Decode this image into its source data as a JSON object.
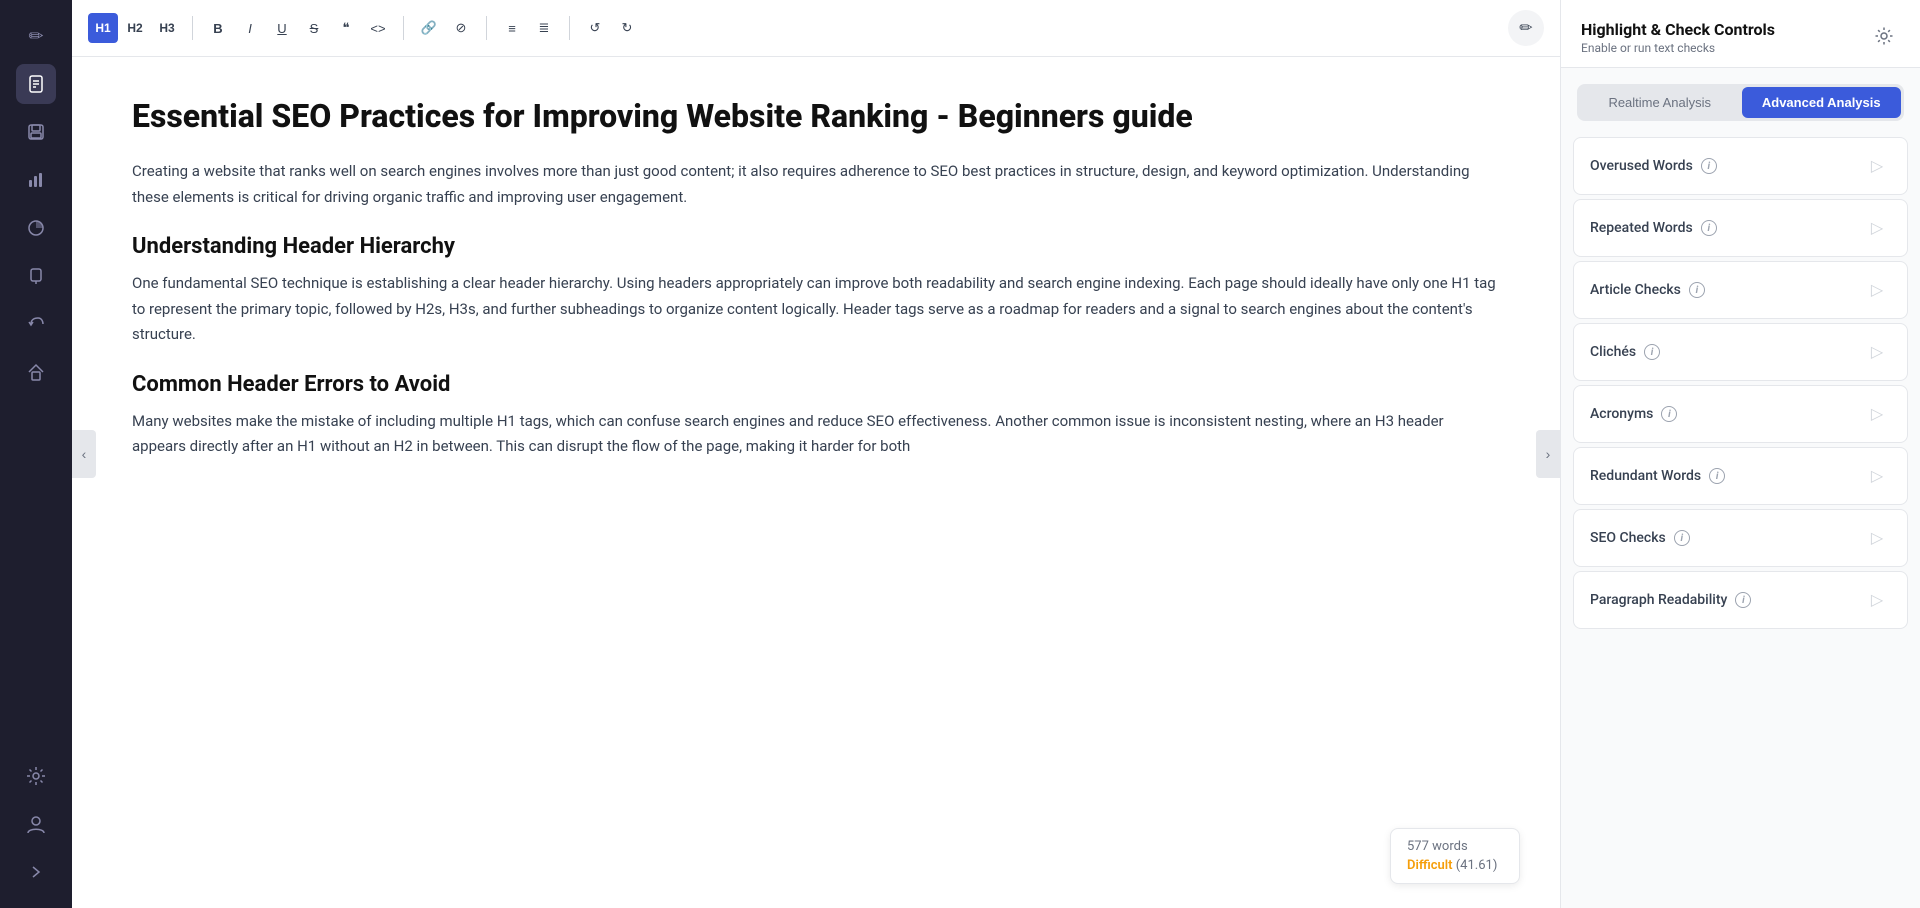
{
  "sidebar": {
    "icons": [
      {
        "name": "edit-icon",
        "symbol": "✏️",
        "active": false
      },
      {
        "name": "document-icon",
        "symbol": "📄",
        "active": true
      },
      {
        "name": "save-icon",
        "symbol": "💾",
        "active": false
      },
      {
        "name": "chart-bar-icon",
        "symbol": "📊",
        "active": false
      },
      {
        "name": "pie-chart-icon",
        "symbol": "🥧",
        "active": false
      },
      {
        "name": "marker-icon",
        "symbol": "🖊️",
        "active": false
      },
      {
        "name": "undo-icon",
        "symbol": "↩",
        "active": false
      },
      {
        "name": "home-icon",
        "symbol": "⌂",
        "active": false
      },
      {
        "name": "settings-icon",
        "symbol": "⚙",
        "active": false
      },
      {
        "name": "user-icon",
        "symbol": "👤",
        "active": false
      },
      {
        "name": "arrow-right-icon",
        "symbol": "→",
        "active": false
      }
    ]
  },
  "toolbar": {
    "h1_label": "H1",
    "h2_label": "H2",
    "h3_label": "H3",
    "bold_label": "B",
    "italic_label": "I",
    "underline_label": "U",
    "strikethrough_label": "S",
    "quote_label": "❝",
    "code_label": "<>",
    "link_label": "🔗",
    "clear_label": "⊘",
    "list_label": "≡",
    "ordered_list_label": "≣",
    "undo_label": "↺",
    "redo_label": "↻",
    "edit_icon": "✏"
  },
  "editor": {
    "title": "Essential SEO Practices for Improving Website Ranking - Beginners guide",
    "paragraphs": [
      "Creating a website that ranks well on search engines involves more than just good content; it also requires adherence to SEO best practices in structure, design, and keyword optimization. Understanding these elements is critical for driving organic traffic and improving user engagement.",
      "",
      "Understanding Header Hierarchy",
      "One fundamental SEO technique is establishing a clear header hierarchy. Using headers appropriately can improve both readability and search engine indexing. Each page should ideally have only one H1 tag to represent the primary topic, followed by H2s, H3s, and further subheadings to organize content logically. Header tags serve as a roadmap for readers and a signal to search engines about the content's structure.",
      "Common Header Errors to Avoid",
      "Many websites make the mistake of including multiple H1 tags, which can confuse search engines and reduce SEO effectiveness. Another common issue is inconsistent nesting, where an H3 header appears directly after an H1 without an H2 in between. This can disrupt the flow of the page, making it harder for both"
    ],
    "word_count": "577 words",
    "difficulty_label": "Difficult",
    "difficulty_score": "(41.61)"
  },
  "panel": {
    "header_title": "Highlight & Check Controls",
    "header_subtitle": "Enable or run text checks",
    "settings_icon": "⚙",
    "tabs": [
      {
        "label": "Realtime Analysis",
        "active": false
      },
      {
        "label": "Advanced Analysis",
        "active": true
      }
    ],
    "checks": [
      {
        "label": "Overused Words",
        "info": true
      },
      {
        "label": "Repeated Words",
        "info": true
      },
      {
        "label": "Article Checks",
        "info": true
      },
      {
        "label": "Clichés",
        "info": true
      },
      {
        "label": "Acronyms",
        "info": true
      },
      {
        "label": "Redundant Words",
        "info": true
      },
      {
        "label": "SEO Checks",
        "info": true
      },
      {
        "label": "Paragraph Readability",
        "info": true
      }
    ]
  }
}
